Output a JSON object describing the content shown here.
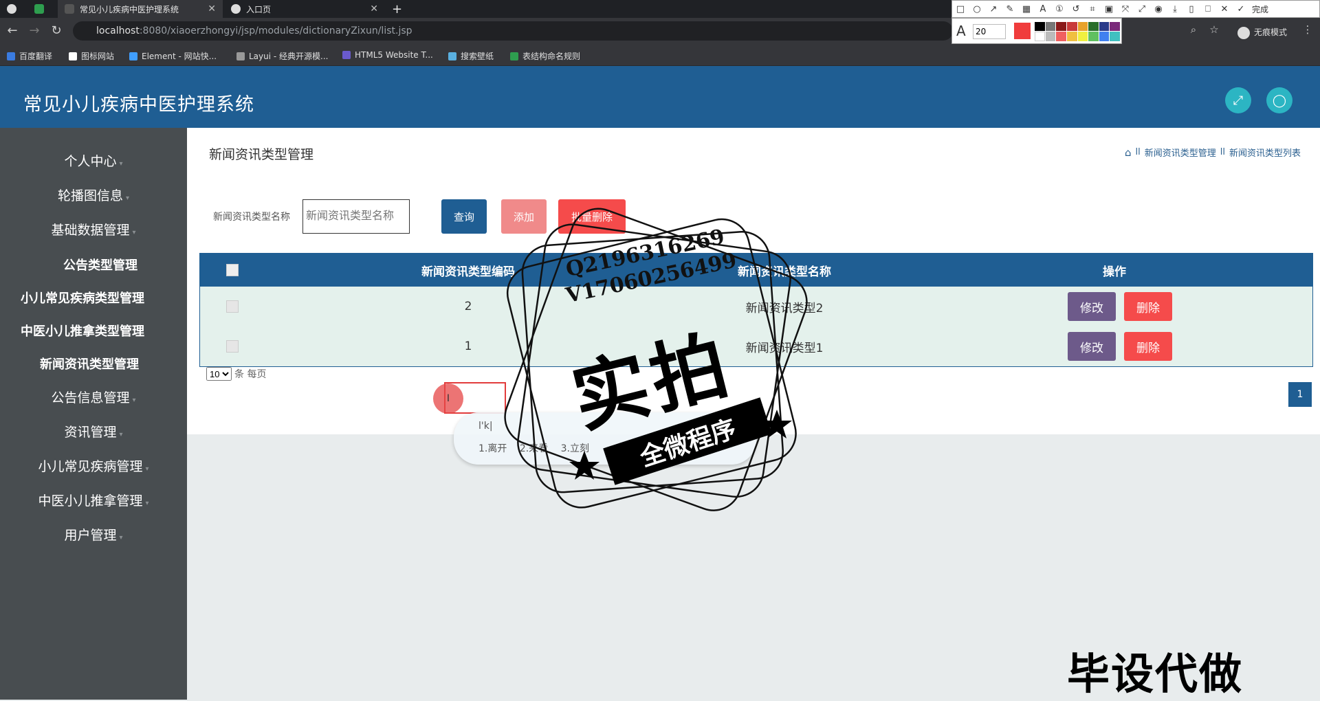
{
  "browser": {
    "tabs": [
      {
        "label": "常见小儿疾病中医护理系统",
        "active": true
      },
      {
        "label": "入口页",
        "active": false
      }
    ],
    "new_tab": "+",
    "url_host": "localhost",
    "url_path": ":8080/xiaoerzhongyi/jsp/modules/dictionaryZixun/list.jsp",
    "bookmarks": [
      "百度翻译",
      "图标网站",
      "Element - 网站快...",
      "Layui - 经典开源模...",
      "HTML5 Website T...",
      "搜索壁纸",
      "表结构命名规则"
    ],
    "incognito_label": "无痕模式",
    "annot_done": "完成",
    "annot_font_size": "20"
  },
  "app": {
    "title": "常见小儿疾病中医护理系统"
  },
  "sidebar": {
    "items": [
      {
        "label": "个人中心"
      },
      {
        "label": "轮播图信息"
      },
      {
        "label": "基础数据管理"
      },
      {
        "label": "公告类型管理"
      },
      {
        "label": "小儿常见疾病类型管理"
      },
      {
        "label": "中医小儿推拿类型管理"
      },
      {
        "label": "新闻资讯类型管理"
      },
      {
        "label": "公告信息管理"
      },
      {
        "label": "资讯管理"
      },
      {
        "label": "小儿常见疾病管理"
      },
      {
        "label": "中医小儿推拿管理"
      },
      {
        "label": "用户管理"
      }
    ]
  },
  "main": {
    "page_title": "新闻资讯类型管理",
    "breadcrumb": [
      "新闻资讯类型管理",
      "新闻资讯类型列表"
    ],
    "breadcrumb_sep": "ll",
    "search_label": "新闻资讯类型名称",
    "search_placeholder": "新闻资讯类型名称",
    "btn_query": "查询",
    "btn_add": "添加",
    "btn_batch_delete": "批量删除",
    "table": {
      "headers": [
        "新闻资讯类型编码",
        "新闻资讯类型名称",
        "操作"
      ],
      "rows": [
        {
          "code": "2",
          "name": "新闻资讯类型2"
        },
        {
          "code": "1",
          "name": "新闻资讯类型1"
        }
      ],
      "btn_edit": "修改",
      "btn_delete": "删除"
    },
    "page_size": "10",
    "page_size_suffix": "条 每页",
    "current_page": "1"
  },
  "ime": {
    "typed": "l'k|",
    "candidates": [
      "1.离开",
      "2.来看",
      "3.立刻"
    ]
  },
  "watermark": {
    "qq": "Q2196316269",
    "vx": "V17060256499",
    "big": "实拍",
    "ribbon": "全微程序",
    "corner": "毕设代做"
  },
  "colors": {
    "header": "#1f5e93",
    "sidebar": "#484d50",
    "btn_query": "#1f5e93",
    "btn_add": "#f08a8a",
    "btn_delete": "#f54b4b",
    "btn_edit": "#6d5a8a"
  }
}
